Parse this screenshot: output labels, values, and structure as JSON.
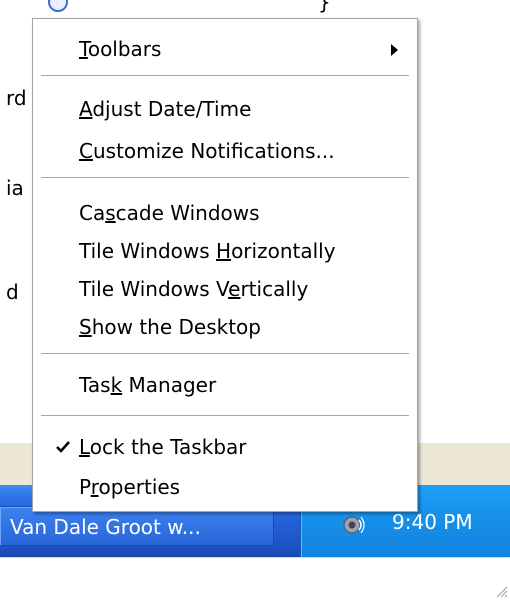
{
  "background": {
    "partial_texts": [
      "rd",
      "ia",
      "d"
    ]
  },
  "menu": {
    "toolbars": {
      "pre": "",
      "key": "T",
      "post": "oolbars"
    },
    "adjust_date_time": {
      "pre": "",
      "key": "A",
      "post": "djust Date/Time"
    },
    "customize_notifications": {
      "pre": "",
      "key": "C",
      "post": "ustomize Notifications..."
    },
    "cascade_windows": {
      "pre": "Ca",
      "key": "s",
      "post": "cade Windows"
    },
    "tile_horizontally": {
      "pre": "Tile Windows ",
      "key": "H",
      "post": "orizontally"
    },
    "tile_vertically": {
      "pre": "Tile Windows V",
      "key": "e",
      "post": "rtically"
    },
    "show_desktop": {
      "pre": "",
      "key": "S",
      "post": "how the Desktop"
    },
    "task_manager": {
      "pre": "Tas",
      "key": "k",
      "post": " Manager"
    },
    "lock_taskbar": {
      "pre": "",
      "key": "L",
      "post": "ock the Taskbar",
      "checked": true
    },
    "properties": {
      "pre": "P",
      "key": "r",
      "post": "operties"
    }
  },
  "taskbar": {
    "task_button_label": "Van Dale Groot w...",
    "clock": "9:40 PM",
    "tray_icon": "speaker-volume-icon"
  },
  "colors": {
    "taskbar_blue": "#2560d8",
    "tray_blue": "#1891eb",
    "menu_background": "#ffffff"
  }
}
